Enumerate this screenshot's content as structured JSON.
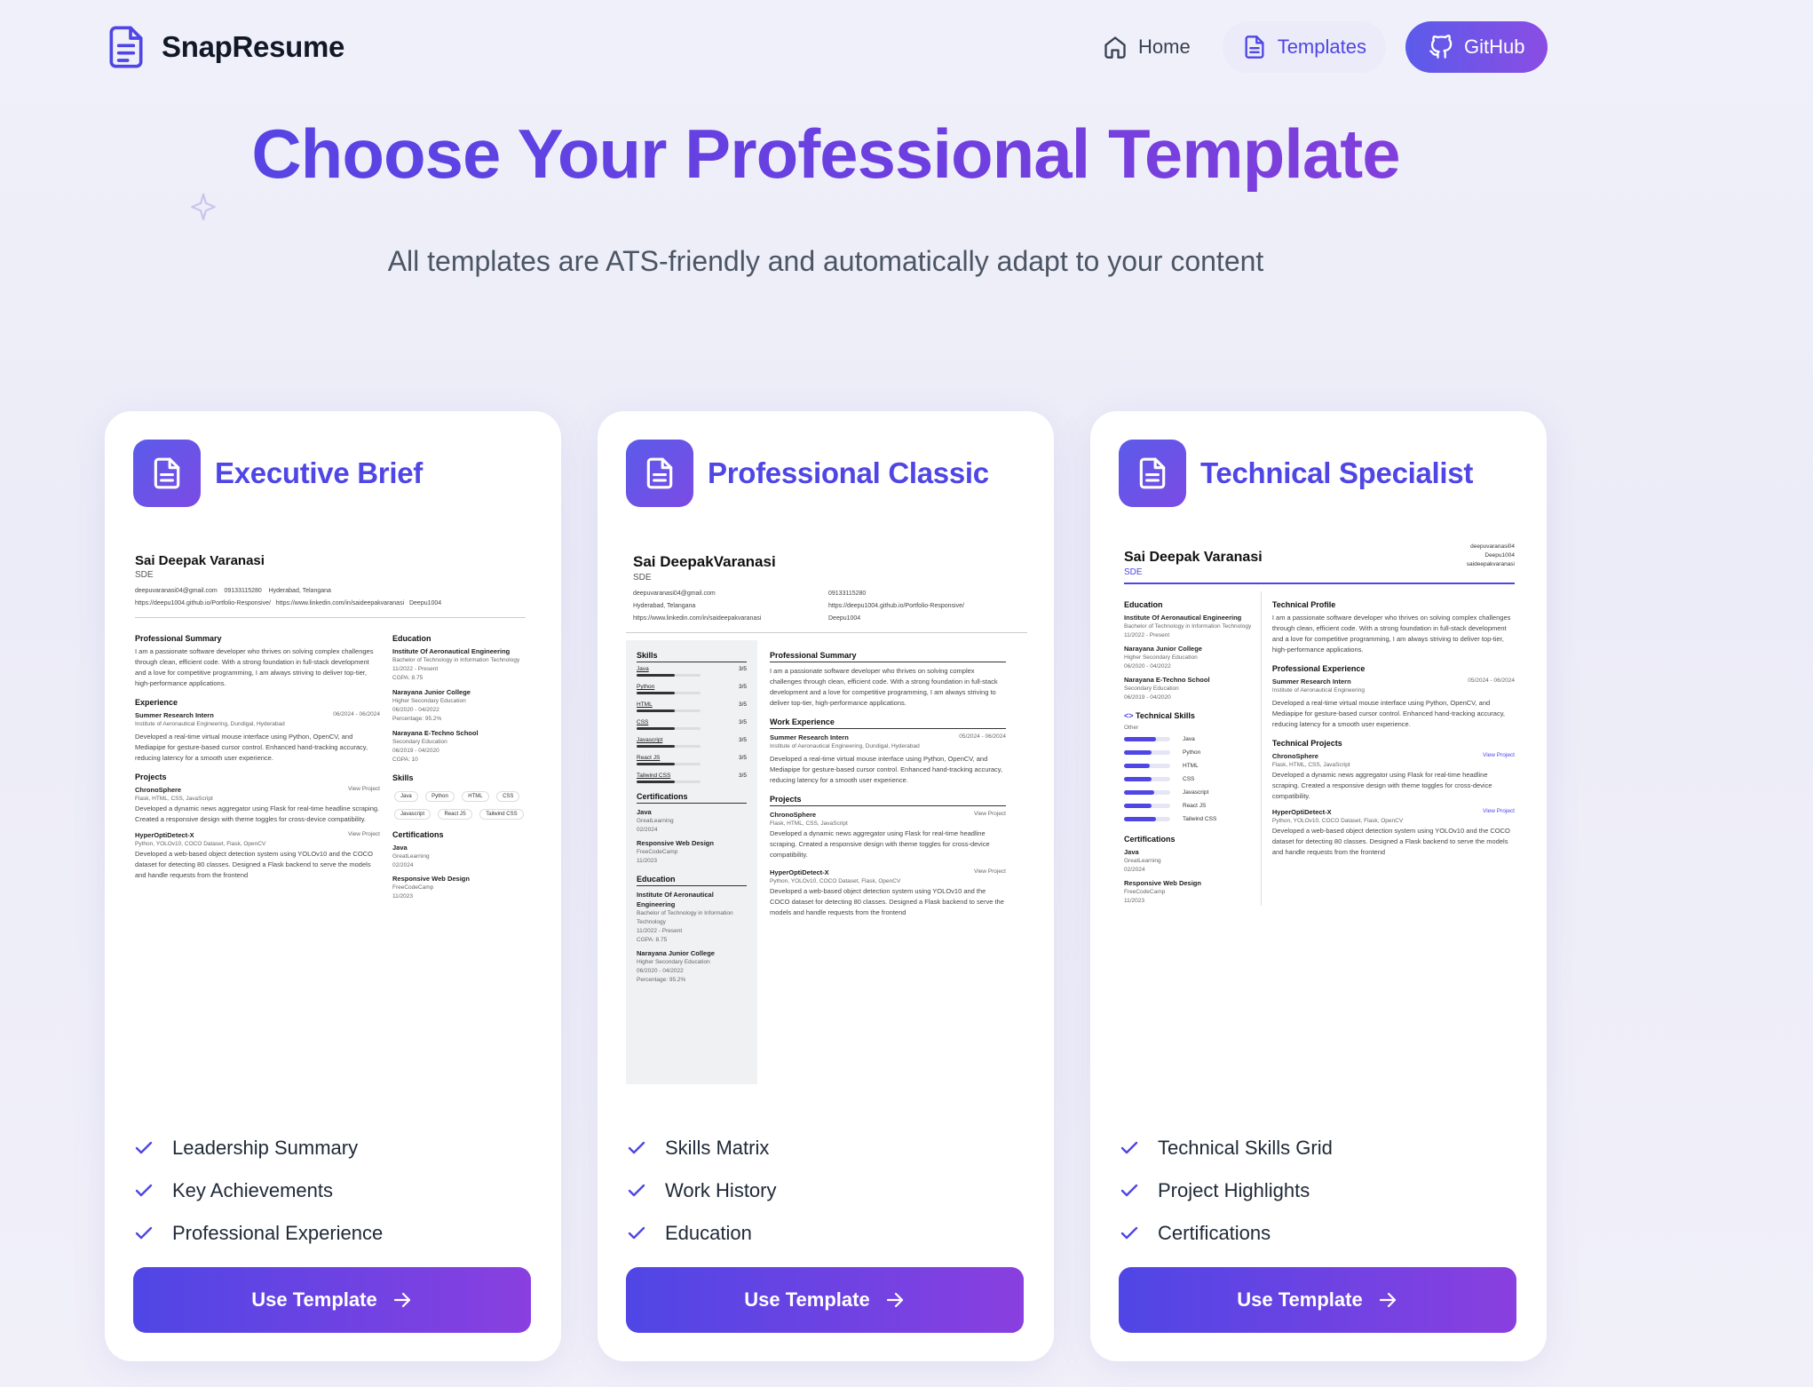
{
  "nav": {
    "brand": "SnapResume",
    "home": "Home",
    "templates": "Templates",
    "github": "GitHub"
  },
  "hero": {
    "title": "Choose Your Professional Template",
    "subtitle": "All templates are ATS-friendly and automatically adapt to your content"
  },
  "colors": {
    "accent": "#4f46e5",
    "accent_end": "#8a3fe0",
    "background": "#efeff9"
  },
  "cards": [
    {
      "title": "Executive Brief",
      "features": [
        "Leadership Summary",
        "Key Achievements",
        "Professional Experience"
      ],
      "button": "Use Template"
    },
    {
      "title": "Professional Classic",
      "features": [
        "Skills Matrix",
        "Work History",
        "Education"
      ],
      "button": "Use Template"
    },
    {
      "title": "Technical Specialist",
      "features": [
        "Technical Skills Grid",
        "Project Highlights",
        "Certifications"
      ],
      "button": "Use Template"
    }
  ],
  "resume": {
    "name": "Sai Deepak Varanasi",
    "name_tight": "Sai DeepakVaranasi",
    "role": "SDE",
    "email": "deepuvaranasi04@gmail.com",
    "email_short": "deepuvaranasi04",
    "phone": "09133115280",
    "location": "Hyderabad, Telangana",
    "portfolio": "https://deepu1004.github.io/Portfolio-Responsive/",
    "linkedin": "https://www.linkedin.com/in/saideepakvaranasi",
    "linkedin_short": "saideepakvaranasi",
    "github": "Deepu1004",
    "summary_h": "Professional Summary",
    "profile_h": "Technical Profile",
    "summary": "I am a passionate software developer who thrives on solving complex challenges through clean, efficient code. With a strong foundation in full-stack development and a love for competitive programming, I am always striving to deliver top-tier, high-performance applications.",
    "experience_h": "Experience",
    "work_h": "Work Experience",
    "pro_exp_h": "Professional Experience",
    "job_title": "Summer Research Intern",
    "job_org": "Institute of Aeronautical Engineering, Dundigal, Hyderabad",
    "job_org_short": "Institute of Aeronautical Engineering",
    "job_dates": "06/2024 - 06/2024",
    "job_dates_alt": "05/2024 - 06/2024",
    "job_desc": "Developed a real-time virtual mouse interface using Python, OpenCV, and Mediapipe for gesture-based cursor control. Enhanced hand-tracking accuracy, reducing latency for a smooth user experience.",
    "projects_h": "Projects",
    "tech_projects_h": "Technical Projects",
    "view_project": "View Project",
    "p1_title": "ChronoSphere",
    "p1_tech": "Flask, HTML, CSS, JavaScript",
    "p1_desc": "Developed a dynamic news aggregator using Flask for real-time headline scraping. Created a responsive design with theme toggles for cross-device compatibility.",
    "p2_title": "HyperOptiDetect-X",
    "p2_tech": "Python, YOLOv10, COCO Dataset, Flask, OpenCV",
    "p2_desc": "Developed a web-based object detection system using YOLOv10 and the COCO dataset for detecting 80 classes. Designed a Flask backend to serve the models and handle requests from the frontend",
    "education_h": "Education",
    "e1_school": "Institute Of Aeronautical Engineering",
    "e1_degree": "Bachelor of Technology in Information Technology",
    "e1_dates": "11/2022 - Present",
    "e1_grade": "CGPA: 8.75",
    "e2_school": "Narayana Junior College",
    "e2_degree": "Higher Secondary Education",
    "e2_dates": "06/2020 - 04/2022",
    "e2_grade": "Percentage: 95.2%",
    "e3_school": "Narayana E-Techno School",
    "e3_degree": "Secondary Education",
    "e3_dates": "06/2019 - 04/2020",
    "e3_grade": "CGPA: 10",
    "skills_h": "Skills",
    "tech_skills_h": "Technical Skills",
    "other": "Other",
    "skills": [
      "Java",
      "Python",
      "HTML",
      "CSS",
      "Javascript",
      "React JS",
      "Tailwind CSS"
    ],
    "skill_score": "3/5",
    "skill_level": [
      0.6,
      0.6,
      0.6,
      0.6,
      0.6,
      0.6,
      0.6
    ],
    "tech_skill_level": [
      0.7,
      0.6,
      0.55,
      0.6,
      0.65,
      0.6,
      0.7
    ],
    "cert_h": "Certifications",
    "c1_title": "Java",
    "c1_org": "GreatLearning",
    "c1_date": "02/2024",
    "c2_title": "Responsive Web Design",
    "c2_org": "FreeCodeCamp",
    "c2_date": "11/2023"
  }
}
